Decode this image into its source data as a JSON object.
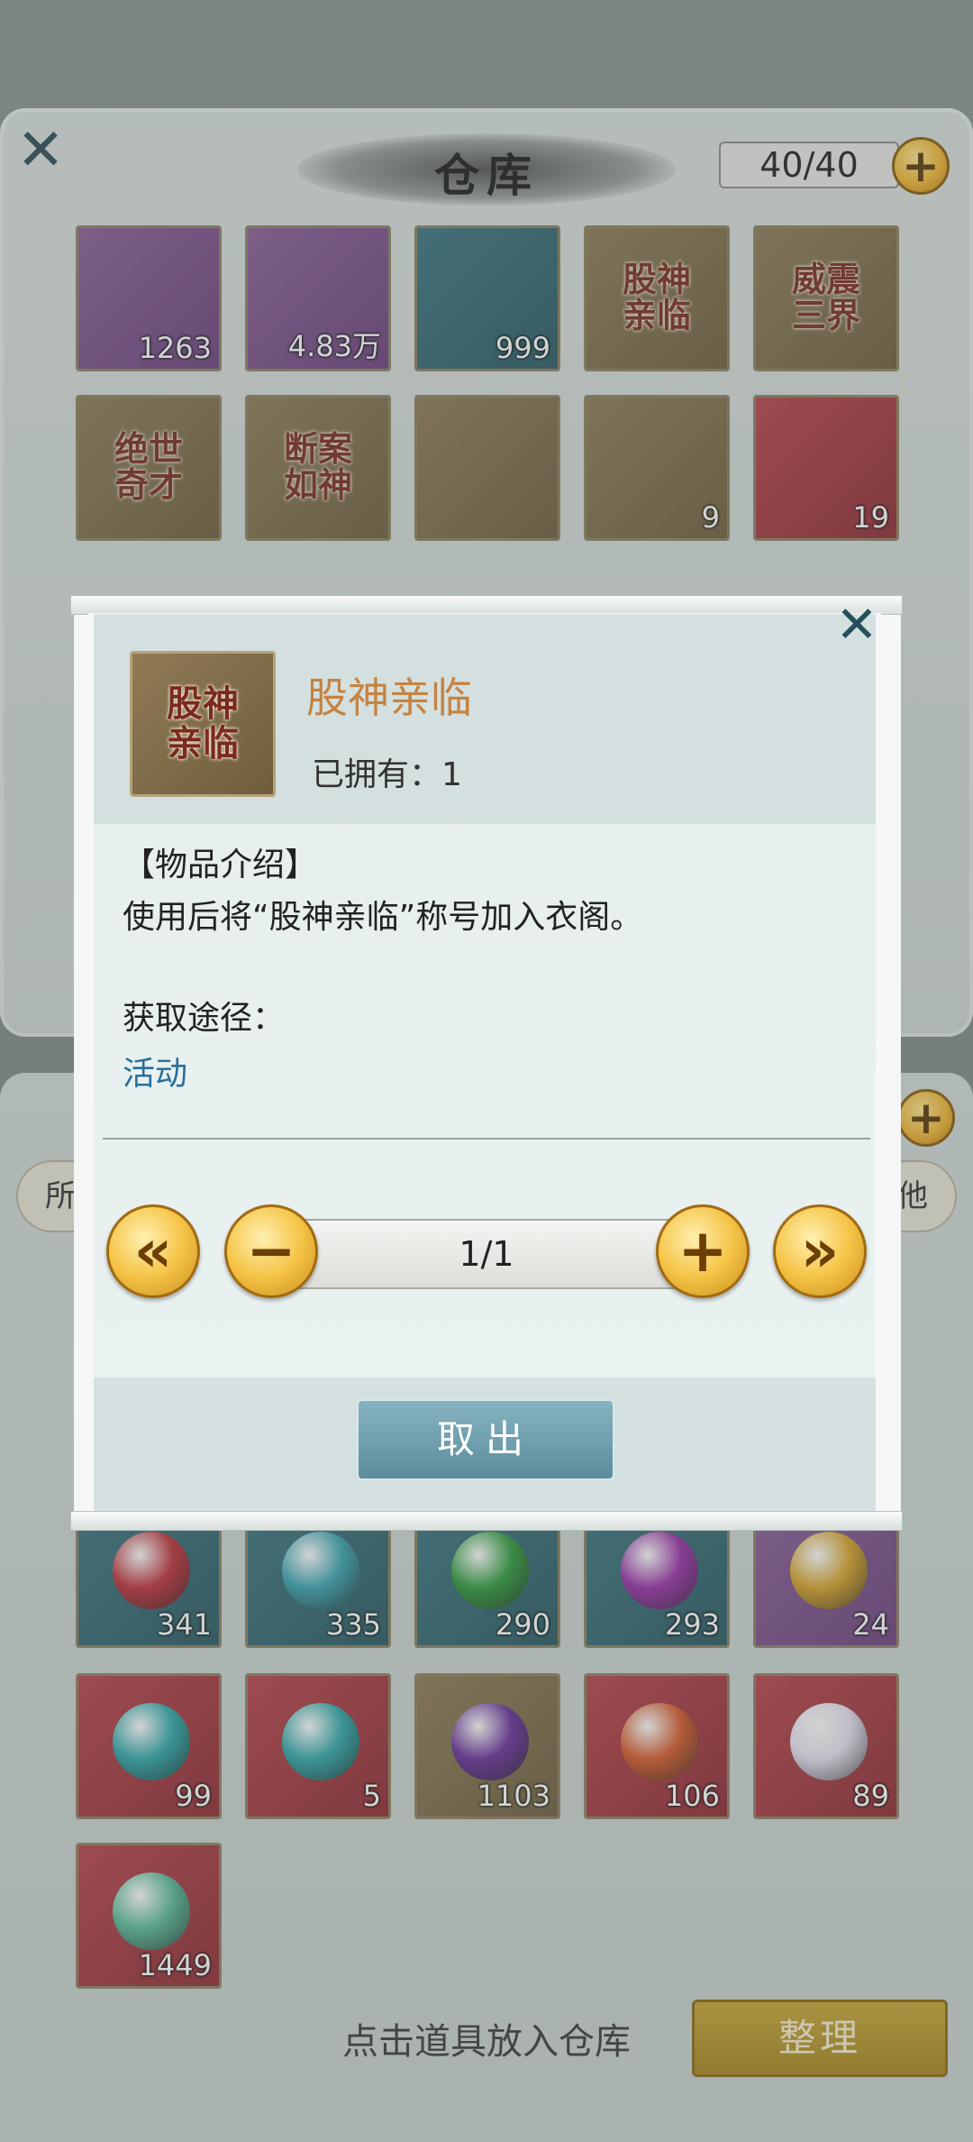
{
  "warehouse": {
    "title": "仓库",
    "capacity": "40/40",
    "close_icon": "close-x-icon"
  },
  "warehouse_items": [
    {
      "count": "1263",
      "bg": "purple"
    },
    {
      "count": "4.83万",
      "bg": "purple"
    },
    {
      "count": "999",
      "bg": "teal"
    },
    {
      "count": "",
      "bg": "gold",
      "text": "股神\n亲临"
    },
    {
      "count": "",
      "bg": "gold",
      "text": "威震\n三界"
    },
    {
      "count": "",
      "bg": "gold",
      "text": "绝世\n奇才"
    },
    {
      "count": "",
      "bg": "gold",
      "text": "断案\n如神"
    },
    {
      "count": "",
      "bg": "gold"
    },
    {
      "count": "9",
      "bg": "gold"
    },
    {
      "count": "19",
      "bg": "red"
    }
  ],
  "bag": {
    "filter_left": "所有",
    "filter_right": "其他",
    "footer_text": "点击道具放入仓库",
    "sort_label": "整理"
  },
  "bag_items": [
    {
      "count": "341",
      "bg": "teal",
      "orb": "#c0303a"
    },
    {
      "count": "335",
      "bg": "teal",
      "orb": "#3aa3b0"
    },
    {
      "count": "290",
      "bg": "teal",
      "orb": "#2f9a3c"
    },
    {
      "count": "293",
      "bg": "teal",
      "orb": "#9a2fa8"
    },
    {
      "count": "24",
      "bg": "purple",
      "orb": "#d8a22a"
    },
    {
      "count": "99",
      "bg": "red",
      "orb": "#2fa6a8"
    },
    {
      "count": "5",
      "bg": "red",
      "orb": "#2fa6a8"
    },
    {
      "count": "1103",
      "bg": "gold",
      "orb": "#6a2f9a"
    },
    {
      "count": "106",
      "bg": "red",
      "orb": "#d8582a"
    },
    {
      "count": "89",
      "bg": "red",
      "orb": "#e8e0f0"
    },
    {
      "count": "1449",
      "bg": "red",
      "orb": "#5ab89a"
    }
  ],
  "modal": {
    "item_icon_text_1": "股神",
    "item_icon_text_2": "亲临",
    "item_name": "股神亲临",
    "owned": "已拥有：1",
    "desc_heading": "【物品介绍】",
    "desc_text": "使用后将“股神亲临”称号加入衣阁。",
    "source_label": "获取途径：",
    "source_link": "活动",
    "pager_value": "1/1",
    "first_label": "«",
    "minus_label": "−",
    "plus_label": "+",
    "last_label": "»",
    "take_out_label": "取出"
  },
  "colors": {
    "item_name": "#c58343",
    "source_link": "#2a6f9a",
    "take_out_button": "#6f9fad",
    "gold_button": "#f5c447"
  }
}
